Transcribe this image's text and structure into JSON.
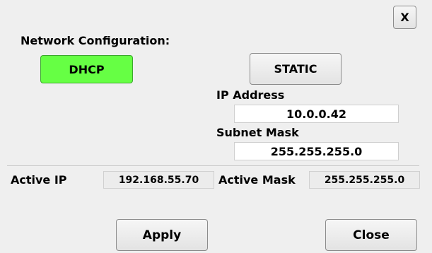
{
  "dialog": {
    "close_x_label": "X",
    "section_title": "Network Configuration:"
  },
  "mode": {
    "dhcp_label": "DHCP",
    "static_label": "STATIC",
    "selected": "DHCP"
  },
  "static_settings": {
    "ip_label": "IP Address",
    "ip_value": "10.0.0.42",
    "mask_label": "Subnet Mask",
    "mask_value": "255.255.255.0"
  },
  "active": {
    "ip_label": "Active IP",
    "ip_value": "192.168.55.70",
    "mask_label": "Active Mask",
    "mask_value": "255.255.255.0"
  },
  "footer": {
    "apply_label": "Apply",
    "close_label": "Close"
  },
  "colors": {
    "selected_mode": "#66ff44",
    "background": "#efefef"
  }
}
